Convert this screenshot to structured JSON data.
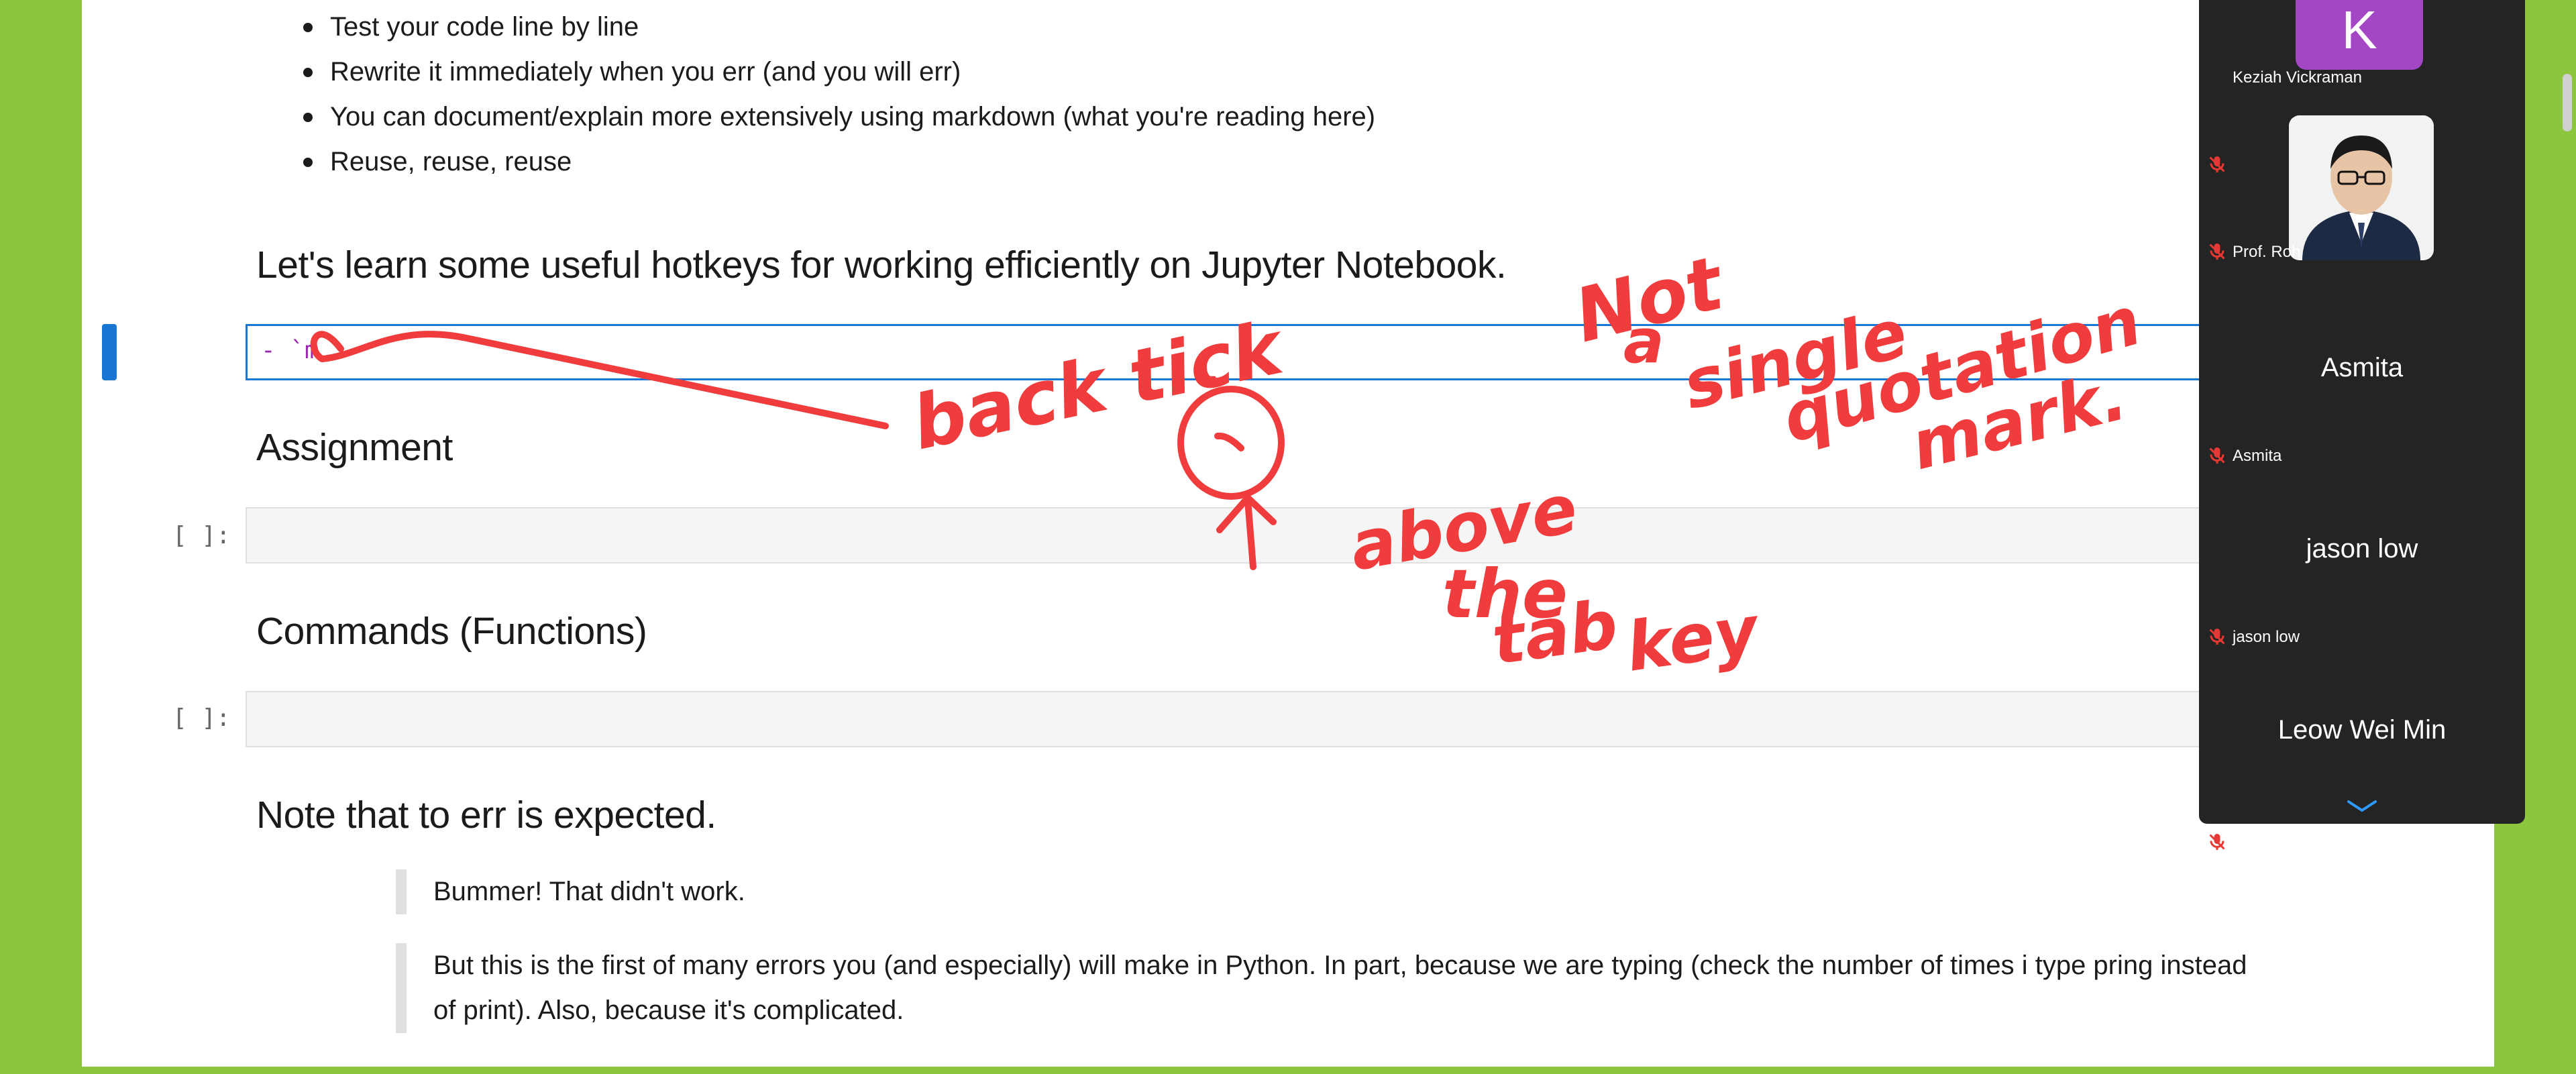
{
  "notebook": {
    "bullets": [
      "Test your code line by line",
      "Rewrite it immediately when you err (and you will err)",
      "You can document/explain more extensively using markdown (what you're reading here)",
      "Reuse, reuse, reuse"
    ],
    "hotkeys_heading": "Let's learn some useful hotkeys for working efficiently on Jupyter Notebook.",
    "md_cell_text": "- `m",
    "assignment_heading": "Assignment",
    "assignment_prompt": "[ ]:",
    "commands_heading": "Commands (Functions)",
    "commands_prompt": "[ ]:",
    "note_heading": "Note that to err is expected.",
    "quote1": "Bummer! That didn't work.",
    "quote2_line1": "But this is the first of many errors you (and especially) will make in Python. In part, because we are typing (check the number of times i type pring instead",
    "quote2_line2": "of print). Also, because it's complicated."
  },
  "annotations": {
    "back_tick": "back tick",
    "symbol": "`",
    "above_the_tab_key": [
      "above",
      "the",
      "tab",
      "key"
    ],
    "not_single_quote": [
      "Not",
      "a",
      "single",
      "quotation",
      "mark."
    ]
  },
  "participants": [
    {
      "name": "Keziah Vickraman",
      "initial": "K",
      "muted": true
    },
    {
      "name": "Prof. Roh",
      "muted": true
    },
    {
      "name": "Asmita",
      "muted": true
    },
    {
      "name": "jason low",
      "muted": true
    },
    {
      "name": "Leow Wei Min",
      "muted": true
    }
  ],
  "colors": {
    "accent": "#1976d2",
    "annotation": "#f03c3c",
    "frame": "#8cc63f",
    "panel": "#242424",
    "avatar_k": "#a347c4"
  }
}
